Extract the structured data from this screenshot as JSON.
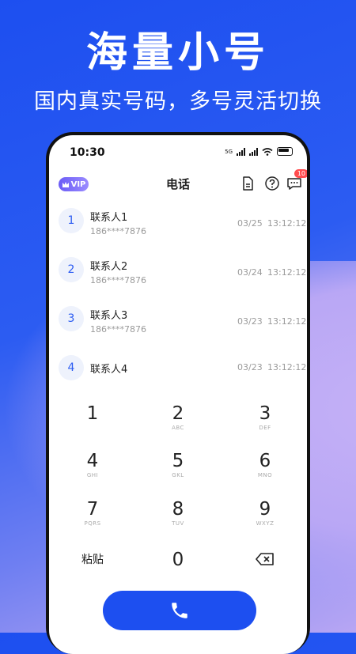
{
  "promo": {
    "headline": "海量小号",
    "subline": "国内真实号码，多号灵活切换"
  },
  "status_bar": {
    "time": "10:30",
    "network": "5G"
  },
  "app_bar": {
    "vip_label": "VIP",
    "title": "电话",
    "messages_badge": "10"
  },
  "contacts": [
    {
      "index": "1",
      "name": "联系人1",
      "phone": "186****7876",
      "date": "03/25",
      "time": "13:12:12"
    },
    {
      "index": "2",
      "name": "联系人2",
      "phone": "186****7876",
      "date": "03/24",
      "time": "13:12:12"
    },
    {
      "index": "3",
      "name": "联系人3",
      "phone": "186****7876",
      "date": "03/23",
      "time": "13:12:12"
    },
    {
      "index": "4",
      "name": "联系人4",
      "phone": "",
      "date": "03/23",
      "time": "13:12:12"
    }
  ],
  "keypad": {
    "keys": [
      {
        "digit": "1",
        "letters": ""
      },
      {
        "digit": "2",
        "letters": "ABC"
      },
      {
        "digit": "3",
        "letters": "DEF"
      },
      {
        "digit": "4",
        "letters": "GHI"
      },
      {
        "digit": "5",
        "letters": "GKL"
      },
      {
        "digit": "6",
        "letters": "MNO"
      },
      {
        "digit": "7",
        "letters": "PQRS"
      },
      {
        "digit": "8",
        "letters": "TUV"
      },
      {
        "digit": "9",
        "letters": "WXYZ"
      },
      {
        "digit": "0",
        "letters": ""
      }
    ],
    "paste_label": "粘贴"
  },
  "colors": {
    "accent": "#1d4ff0",
    "badge": "#ff4d4f",
    "vip": "#7b6cf7"
  },
  "icons": [
    "vip-crown-icon",
    "sim-card-icon",
    "help-icon",
    "message-icon",
    "backspace-icon",
    "phone-icon"
  ]
}
